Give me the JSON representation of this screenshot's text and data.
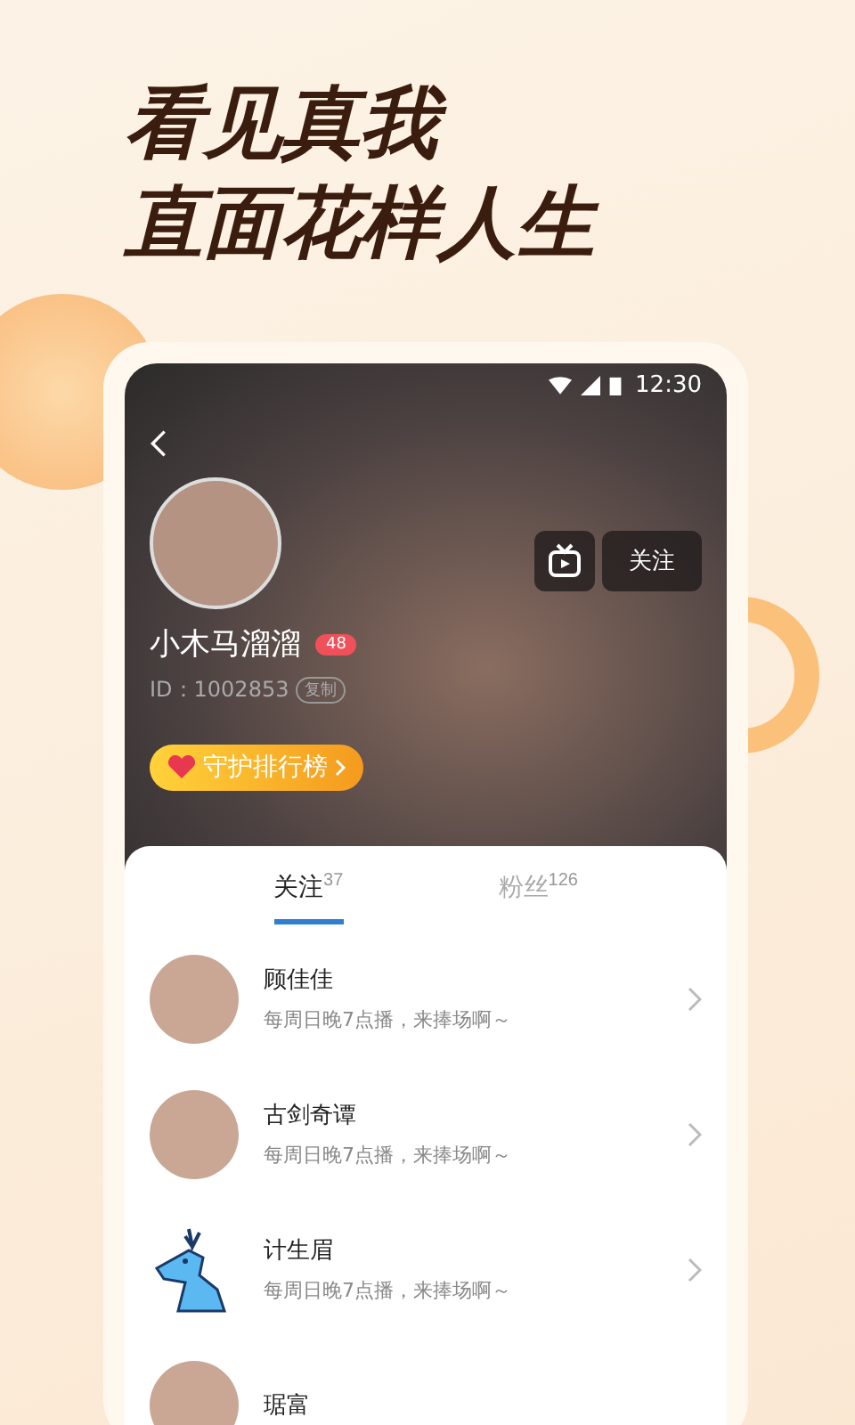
{
  "headline": [
    "看见真我",
    "直面花样人生"
  ],
  "status_bar": {
    "time": "12:30"
  },
  "profile": {
    "name": "小木马溜溜",
    "level": "48",
    "id": "ID：1002853",
    "copy": "复制",
    "ranking": "守护排行榜",
    "follow": "关注"
  },
  "tabs": [
    {
      "label": "关注",
      "count": "37",
      "selected": true
    },
    {
      "label": "粉丝",
      "count": "126",
      "selected": false
    }
  ],
  "users": [
    {
      "name": "顾佳佳",
      "bio": "每周日晚7点播，来捧场啊～",
      "kind": "photo"
    },
    {
      "name": "古剑奇谭",
      "bio": "每周日晚7点播，来捧场啊～",
      "kind": "photo"
    },
    {
      "name": "计生眉",
      "bio": "每周日晚7点播，来捧场啊～",
      "kind": "drawing"
    },
    {
      "name": "琚富",
      "kind": "photo"
    }
  ]
}
